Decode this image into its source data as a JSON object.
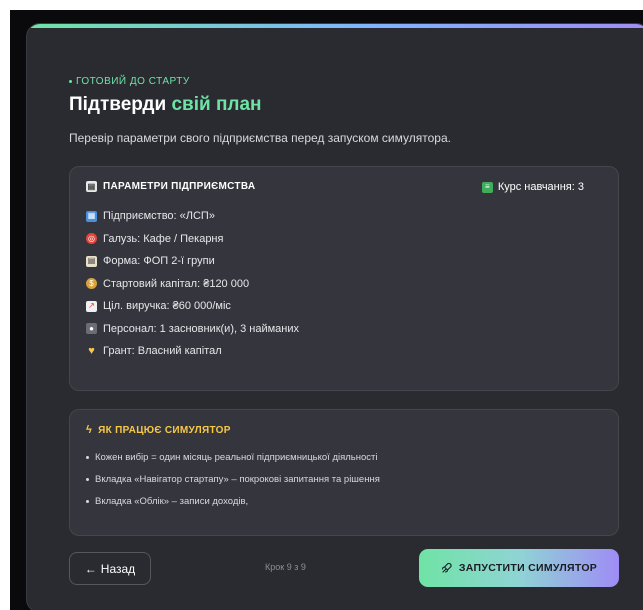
{
  "step_label": "ГОТОВИЙ ДО СТАРТУ",
  "title": {
    "main": "Підтверди ",
    "accent": "свій план"
  },
  "subtitle": "Перевір параметри свого підприємства перед запуском симулятора.",
  "params_panel": {
    "heading": "ПАРАМЕТРИ ПІДПРИЄМСТВА",
    "course": "Курс навчання: 3",
    "items": [
      {
        "icon": "building-icon",
        "text": "Підприємство: «ЛСП»"
      },
      {
        "icon": "target-icon",
        "text": "Галузь: Кафе / Пекарня"
      },
      {
        "icon": "clipboard-icon",
        "text": "Форма: ФОП 2-ї групи"
      },
      {
        "icon": "money-bag-icon",
        "text": "Стартовий капітал: ₴120 000"
      },
      {
        "icon": "chart-icon",
        "text": "Ціл. виручка: ₴60 000/міс"
      },
      {
        "icon": "people-icon",
        "text": "Персонал: 1 засновник(и), 3 найманих"
      },
      {
        "icon": "heart-icon",
        "text": "Грант: Власний капітал"
      }
    ]
  },
  "how_panel": {
    "heading": "ЯК ПРАЦЮЄ СИМУЛЯТОР",
    "bullets": [
      "Кожен вибір = один місяць реальної підприємницької діяльності",
      "Вкладка «Навігатор стартапу» – покрокові запитання та рішення",
      "Вкладка «Облік» – записи доходів,"
    ]
  },
  "nav": {
    "back_label": "Назад",
    "step_count": "Крок 9 з 9",
    "start_label": "ЗАПУСТИТИ СИМУЛЯТОР"
  },
  "colors": {
    "accent": "#6fe3a5",
    "warning": "#f7c948",
    "gradient_end": "#9f8cf6"
  }
}
